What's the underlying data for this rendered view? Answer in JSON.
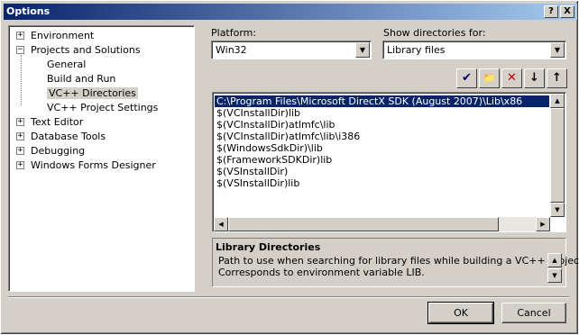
{
  "window": {
    "title": "Options",
    "help_glyph": "?",
    "close_glyph": "X"
  },
  "tree": {
    "items": [
      {
        "label": "Environment",
        "expander": "+"
      },
      {
        "label": "Projects and Solutions",
        "expander": "−"
      },
      {
        "label": "General"
      },
      {
        "label": "Build and Run"
      },
      {
        "label": "VC++ Directories",
        "selected": true
      },
      {
        "label": "VC++ Project Settings"
      },
      {
        "label": "Text Editor",
        "expander": "+"
      },
      {
        "label": "Database Tools",
        "expander": "+"
      },
      {
        "label": "Debugging",
        "expander": "+"
      },
      {
        "label": "Windows Forms Designer",
        "expander": "+"
      }
    ]
  },
  "platform": {
    "label": "Platform:",
    "value": "Win32"
  },
  "show_dirs": {
    "label": "Show directories for:",
    "value": "Library files"
  },
  "toolbar": {
    "check_glyph": "✔",
    "newfolder_glyph": "📁",
    "delete_glyph": "✕",
    "down_glyph": "↓",
    "up_glyph": "↑",
    "delete_color": "#c00000",
    "check_color": "#000080"
  },
  "directories": [
    "C:\\Program Files\\Microsoft DirectX SDK (August 2007)\\Lib\\x86",
    "$(VCInstallDir)lib",
    "$(VCInstallDir)atlmfc\\lib",
    "$(VCInstallDir)atlmfc\\lib\\i386",
    "$(WindowsSdkDir)\\lib",
    "$(FrameworkSDKDir)lib",
    "$(VSInstallDir)",
    "$(VSInstallDir)lib"
  ],
  "description": {
    "title": "Library Directories",
    "line1": "Path to use when searching for library files while building a VC++ project.",
    "line2": "Corresponds to environment variable LIB."
  },
  "buttons": {
    "ok": "OK",
    "cancel": "Cancel"
  },
  "colors": {
    "titlebar_start": "#0a246a",
    "titlebar_end": "#a6caf0",
    "selection": "#0a246a",
    "face": "#d4d0c8"
  }
}
